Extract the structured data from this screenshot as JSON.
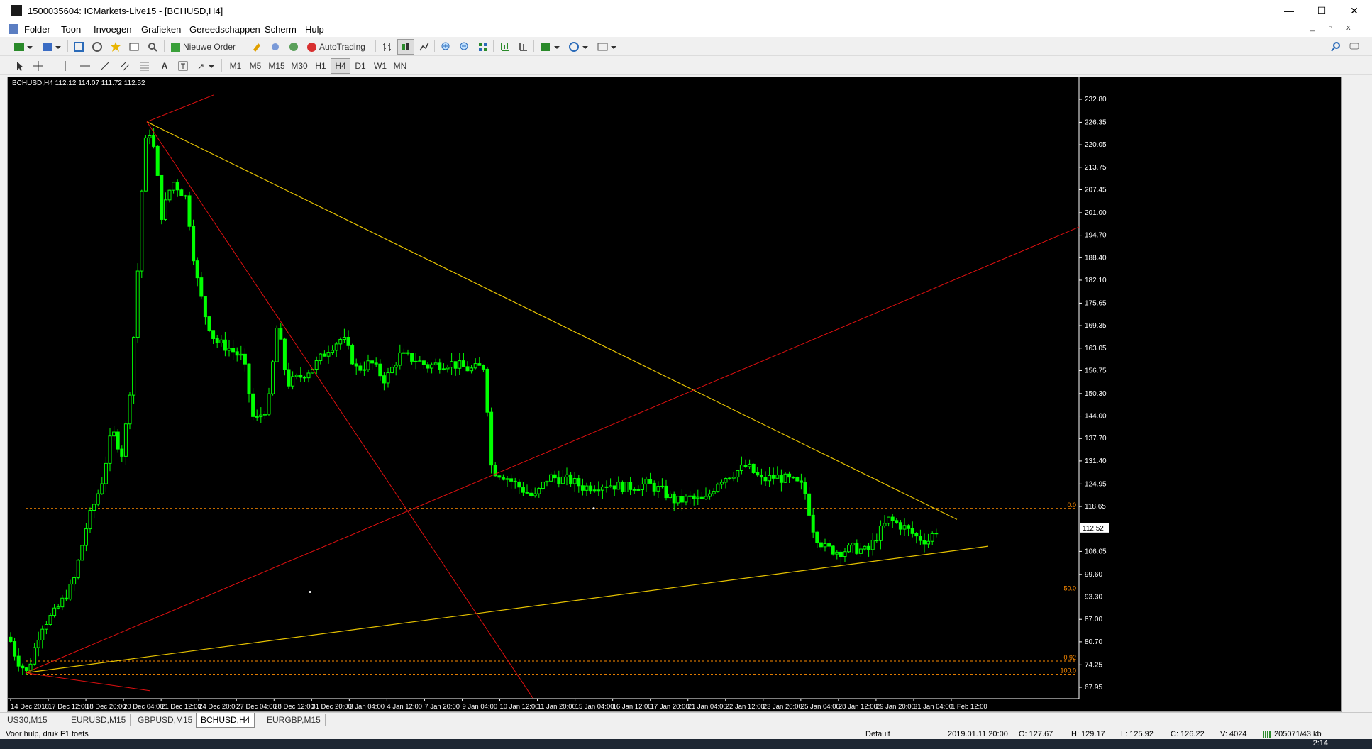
{
  "window": {
    "title": "1500035604: ICMarkets-Live15 - [BCHUSD,H4]",
    "minimize": "—",
    "maximize": "☐",
    "close": "✕"
  },
  "menu": [
    "Folder",
    "Toon",
    "Invoegen",
    "Grafieken",
    "Gereedschappen",
    "Scherm",
    "Hulp"
  ],
  "mdi_controls": [
    "_",
    "▫",
    "x"
  ],
  "toolbar": {
    "new_order": "Nieuwe Order",
    "autotrading": "AutoTrading"
  },
  "timeframes": [
    "M1",
    "M5",
    "M15",
    "M30",
    "H1",
    "H4",
    "D1",
    "W1",
    "MN"
  ],
  "active_timeframe": "H4",
  "chart": {
    "info": "BCHUSD,H4  112.12 114.07 111.72 112.52",
    "current_price": "112.52",
    "price_axis": [
      "232.80",
      "226.35",
      "220.05",
      "213.75",
      "207.45",
      "201.00",
      "194.70",
      "188.40",
      "182.10",
      "175.65",
      "169.35",
      "163.05",
      "156.75",
      "150.30",
      "144.00",
      "137.70",
      "131.40",
      "124.95",
      "118.65",
      "112.52",
      "106.05",
      "99.60",
      "93.30",
      "87.00",
      "80.70",
      "74.25",
      "67.95"
    ],
    "time_axis": [
      "14 Dec 2018",
      "17 Dec 12:00",
      "18 Dec 20:00",
      "20 Dec 04:00",
      "21 Dec 12:00",
      "24 Dec 20:00",
      "27 Dec 04:00",
      "28 Dec 12:00",
      "31 Dec 20:00",
      "3 Jan 04:00",
      "4 Jan 12:00",
      "7 Jan 20:00",
      "9 Jan 04:00",
      "10 Jan 12:00",
      "11 Jan 20:00",
      "15 Jan 04:00",
      "16 Jan 12:00",
      "17 Jan 20:00",
      "21 Jan 04:00",
      "22 Jan 12:00",
      "23 Jan 20:00",
      "25 Jan 04:00",
      "28 Jan 12:00",
      "29 Jan 20:00",
      "31 Jan 04:00",
      "1 Feb 12:00"
    ],
    "fib_levels": [
      {
        "label": "0.0",
        "price": 118.1
      },
      {
        "label": "50.0",
        "price": 94.7
      },
      {
        "label": "0.92",
        "price": 75.3
      },
      {
        "label": "100.0",
        "price": 71.6
      }
    ],
    "colors": {
      "bg": "#000000",
      "candle": "#00ff00",
      "trend_yellow": "#e6c200",
      "trend_red": "#e01010",
      "fib": "#ff8c00",
      "axis_text": "#ffffff"
    }
  },
  "tabs": [
    "US30,M15",
    "EURUSD,M15",
    "GBPUSD,M15",
    "BCHUSD,H4",
    "EURGBP,M15"
  ],
  "active_tab": "BCHUSD,H4",
  "status": {
    "help": "Voor hulp, druk F1 toets",
    "profile": "Default",
    "datetime": "2019.01.11 20:00",
    "open": "O: 127.67",
    "high": "H: 129.17",
    "low": "L: 125.92",
    "close": "C: 126.22",
    "volume": "V: 4024",
    "traffic": "205071/43 kb"
  },
  "taskbar": {
    "time": "2:14"
  }
}
